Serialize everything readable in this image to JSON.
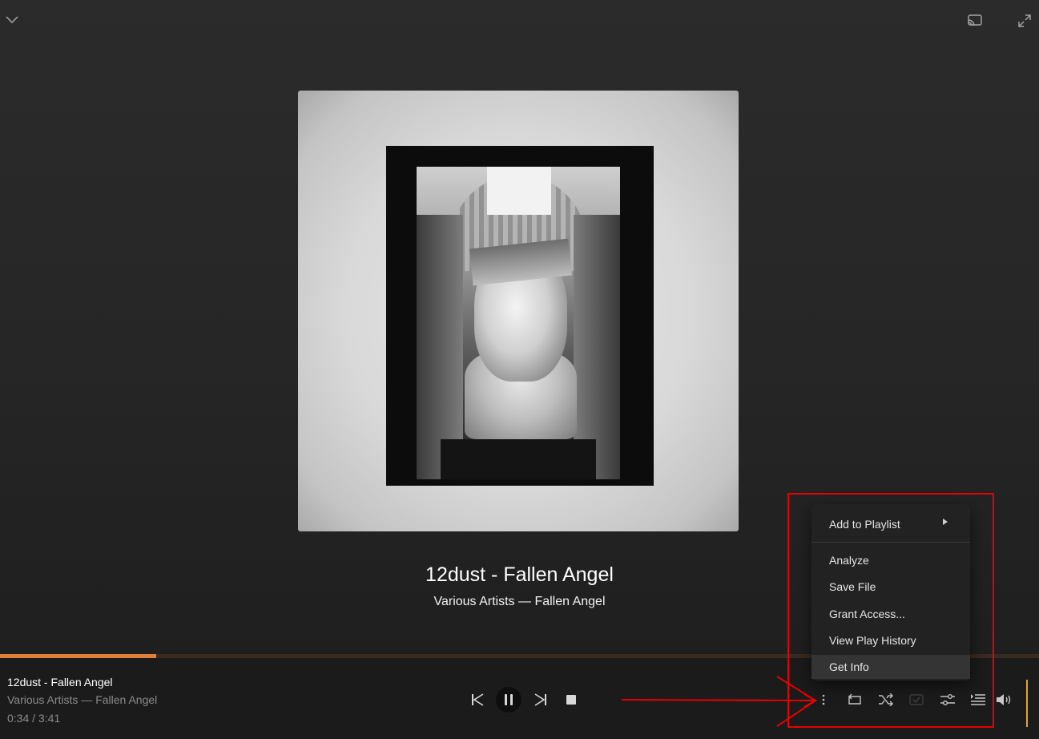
{
  "header": {
    "collapse_icon": "chevron-down-icon",
    "cast_icon": "cast-icon",
    "fullscreen_icon": "expand-icon"
  },
  "album_art": {
    "description_icon": "album-art"
  },
  "now_playing": {
    "title": "12dust - Fallen Angel",
    "subtitle": "Various Artists — Fallen Angel"
  },
  "progress": {
    "current": "0:34",
    "total": "3:41",
    "fraction": 0.15,
    "fill_color": "#e0803a"
  },
  "bottom_bar": {
    "title": "12dust - Fallen Angel",
    "subtitle": "Various Artists — Fallen Angel",
    "time": "0:34 / 3:41",
    "controls": [
      "previous-icon",
      "pause-icon",
      "next-icon",
      "stop-icon"
    ],
    "right_controls": [
      "more-vertical-icon",
      "repeat-icon",
      "shuffle-icon",
      "lyrics-icon",
      "equalizer-icon",
      "queue-icon",
      "volume-icon"
    ],
    "volume_color": "#e2a33a"
  },
  "context_menu": {
    "items": [
      {
        "label": "Add to Playlist",
        "has_submenu": true
      },
      {
        "label": "Analyze"
      },
      {
        "label": "Save File"
      },
      {
        "label": "Grant Access..."
      },
      {
        "label": "View Play History"
      },
      {
        "label": "Get Info",
        "highlighted": true
      }
    ]
  },
  "annotation": {
    "color": "#e60000"
  }
}
